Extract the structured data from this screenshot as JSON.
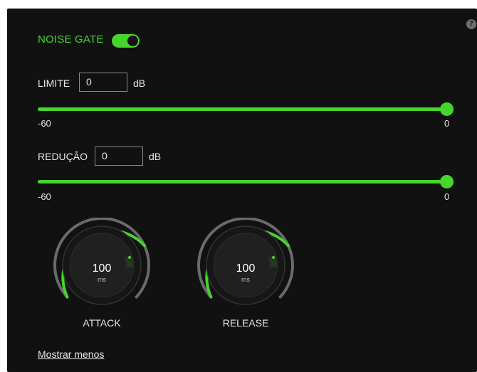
{
  "noise_gate": {
    "label": "NOISE GATE",
    "enabled": true
  },
  "limit": {
    "label": "LIMITE",
    "value": "0",
    "unit": "dB",
    "min_label": "-60",
    "max_label": "0",
    "min": -60,
    "max": 0,
    "current": 0
  },
  "reduction": {
    "label": "REDUÇÃO",
    "value": "0",
    "unit": "dB",
    "min_label": "-60",
    "max_label": "0",
    "min": -60,
    "max": 0,
    "current": 0
  },
  "attack": {
    "label": "ATTACK",
    "value": "100",
    "unit": "ms"
  },
  "release": {
    "label": "RELEASE",
    "value": "100",
    "unit": "ms"
  },
  "show_less": "Mostrar menos",
  "colors": {
    "accent": "#44d62c",
    "background": "#111111",
    "text": "#e6e6e6",
    "track": "#3a3a3a",
    "knob_inactive": "#6a6a6a"
  },
  "icons": {
    "help": "question-mark-circle-icon"
  }
}
